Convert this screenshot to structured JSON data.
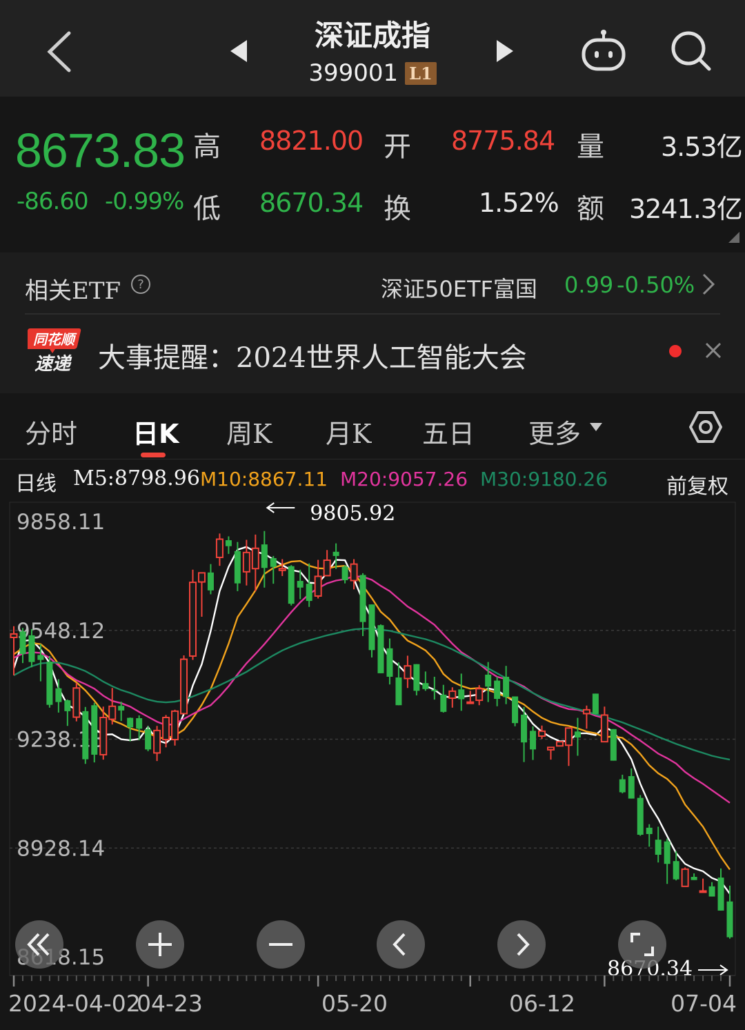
{
  "header": {
    "title": "深证成指",
    "code": "399001",
    "level": "L1"
  },
  "quote": {
    "price": "8673.83",
    "change": "-86.60",
    "change_pct": "-0.99%",
    "high_label": "高",
    "high": "8821.00",
    "open_label": "开",
    "open": "8775.84",
    "volume_label": "量",
    "volume": "3.53亿",
    "low_label": "低",
    "low": "8670.34",
    "turnover_label": "换",
    "turnover": "1.52%",
    "amount_label": "额",
    "amount": "3241.3亿"
  },
  "etf": {
    "label": "相关ETF",
    "name": "深证50ETF富国",
    "price": "0.99",
    "pct": "-0.50%"
  },
  "news": {
    "logo_top": "同花顺",
    "logo_bottom": "速递",
    "text": "大事提醒：2024世界人工智能大会"
  },
  "tabs": [
    {
      "label": "分时"
    },
    {
      "label": "日K"
    },
    {
      "label": "周K"
    },
    {
      "label": "月K"
    },
    {
      "label": "五日"
    },
    {
      "label": "更多"
    }
  ],
  "ma": {
    "kind": "日线",
    "m5": "M5:8798.96",
    "m10": "M10:8867.11",
    "m20": "M20:9057.26",
    "m30": "M30:9180.26",
    "adjust": "前复权"
  },
  "colors": {
    "up": "#f0433a",
    "down": "#2fb34a",
    "m5": "#ffffff",
    "m10": "#f2a31c",
    "m20": "#e2359e",
    "m30": "#1d8a62"
  },
  "chart_data": {
    "type": "candlestick",
    "y_ticks": [
      "9858.11",
      "9548.12",
      "9238.13",
      "8928.14",
      "8618.15"
    ],
    "x_ticks": [
      "2024-04-02",
      "04-23",
      "05-20",
      "06-12",
      "07-04"
    ],
    "high_marker": "9805.92",
    "low_marker": "8670.34",
    "ylim": [
      8618.15,
      9858.11
    ],
    "candles": [
      [
        9528,
        9538,
        9420,
        9560
      ],
      [
        9545,
        9481,
        9455,
        9555
      ],
      [
        9534,
        9458,
        9443,
        9552
      ],
      [
        9478,
        9464,
        9403,
        9509
      ],
      [
        9459,
        9336,
        9328,
        9475
      ],
      [
        9383,
        9344,
        9314,
        9409
      ],
      [
        9349,
        9318,
        9276,
        9351
      ],
      [
        9301,
        9384,
        9289,
        9399
      ],
      [
        9318,
        9181,
        9168,
        9330
      ],
      [
        9335,
        9194,
        9172,
        9342
      ],
      [
        9194,
        9300,
        9180,
        9331
      ],
      [
        9295,
        9332,
        9280,
        9384
      ],
      [
        9333,
        9320,
        9290,
        9345
      ],
      [
        9299,
        9272,
        9232,
        9300
      ],
      [
        9298,
        9268,
        9235,
        9306
      ],
      [
        9267,
        9209,
        9204,
        9275
      ],
      [
        9199,
        9263,
        9176,
        9276
      ],
      [
        9237,
        9300,
        9215,
        9307
      ],
      [
        9237,
        9318,
        9220,
        9322
      ],
      [
        9311,
        9466,
        9309,
        9477
      ],
      [
        9475,
        9685,
        9464,
        9721
      ],
      [
        9686,
        9712,
        9587,
        9709
      ],
      [
        9713,
        9662,
        9651,
        9737
      ],
      [
        9756,
        9808,
        9732,
        9824
      ],
      [
        9805,
        9788,
        9766,
        9816
      ],
      [
        9774,
        9682,
        9660,
        9800
      ],
      [
        9715,
        9770,
        9676,
        9806
      ],
      [
        9724,
        9782,
        9660,
        9821
      ],
      [
        9793,
        9726,
        9670,
        9831
      ],
      [
        9754,
        9729,
        9681,
        9760
      ],
      [
        9719,
        9724,
        9703,
        9751
      ],
      [
        9731,
        9624,
        9619,
        9734
      ],
      [
        9689,
        9670,
        9637,
        9721
      ],
      [
        9681,
        9632,
        9615,
        9739
      ],
      [
        9646,
        9702,
        9639,
        9749
      ],
      [
        9704,
        9748,
        9713,
        9777
      ],
      [
        9772,
        9760,
        9723,
        9796
      ],
      [
        9730,
        9691,
        9682,
        9734
      ],
      [
        9690,
        9737,
        9665,
        9751
      ],
      [
        9706,
        9572,
        9532,
        9711
      ],
      [
        9622,
        9492,
        9471,
        9616
      ],
      [
        9563,
        9426,
        9456,
        9565
      ],
      [
        9497,
        9416,
        9394,
        9525
      ],
      [
        9414,
        9335,
        9351,
        9457
      ],
      [
        9411,
        9447,
        9384,
        9476
      ],
      [
        9452,
        9376,
        9363,
        9452
      ],
      [
        9398,
        9381,
        9376,
        9431
      ],
      [
        9379,
        9375,
        9351,
        9416
      ],
      [
        9365,
        9316,
        9314,
        9393
      ],
      [
        9355,
        9375,
        9328,
        9386
      ],
      [
        9380,
        9352,
        9319,
        9425
      ],
      [
        9343,
        9344,
        9360,
        9376
      ],
      [
        9349,
        9382,
        9335,
        9392
      ],
      [
        9422,
        9388,
        9344,
        9458
      ],
      [
        9405,
        9353,
        9332,
        9416
      ],
      [
        9416,
        9358,
        9338,
        9447
      ],
      [
        9360,
        9284,
        9275,
        9337
      ],
      [
        9308,
        9229,
        9173,
        9330
      ],
      [
        9262,
        9209,
        9179,
        9275
      ],
      [
        9247,
        9261,
        9239,
        9277
      ],
      [
        9208,
        9215,
        9180,
        9209
      ],
      [
        9219,
        9231,
        9238,
        9233
      ],
      [
        9221,
        9270,
        9162,
        9239
      ],
      [
        9260,
        9243,
        9191,
        9299
      ],
      [
        9311,
        9322,
        9268,
        9334
      ],
      [
        9368,
        9310,
        9309,
        9346
      ],
      [
        9231,
        9307,
        9300,
        9331
      ],
      [
        9267,
        9177,
        9192,
        9217
      ],
      [
        9124,
        9087,
        9084,
        9137
      ],
      [
        9133,
        9069,
        9073,
        9155
      ],
      [
        9071,
        8966,
        8963,
        9079
      ],
      [
        8986,
        8968,
        8932,
        8996
      ],
      [
        8952,
        8909,
        8887,
        8989
      ],
      [
        8947,
        8883,
        8826,
        8955
      ],
      [
        8891,
        8839,
        8836,
        8919
      ],
      [
        8819,
        8868,
        8842,
        8873
      ],
      [
        8846,
        8837,
        8844,
        8856
      ],
      [
        8806,
        8806,
        8807,
        8841
      ],
      [
        8819,
        8790,
        8800,
        8831
      ],
      [
        8844,
        8750,
        8753,
        8870
      ],
      [
        8776,
        8674,
        8670,
        8821
      ]
    ],
    "series": [
      {
        "name": "M5",
        "values": [
          9440,
          9518,
          9521,
          9494,
          9455,
          9384,
          9336,
          9322,
          9302,
          9268,
          9251,
          9252,
          9238,
          9235,
          9239,
          9273,
          9235,
          9227,
          9250,
          9310,
          9391,
          9452,
          9546,
          9660,
          9729,
          9778,
          9786,
          9772,
          9766,
          9750,
          9734,
          9720,
          9715,
          9684,
          9682,
          9712,
          9749,
          9748,
          9695,
          9633,
          9580,
          9510,
          9468,
          9448,
          9421,
          9403,
          9390,
          9379,
          9360,
          9357,
          9359,
          9362,
          9366,
          9383,
          9377,
          9361,
          9344,
          9316,
          9282,
          9259,
          9244,
          9232,
          9233,
          9255,
          9255,
          9250,
          9273,
          9260,
          9224,
          9181,
          9111,
          9053,
          9012,
          8962,
          8914,
          8883,
          8870,
          8862,
          8843,
          8833,
          8798
        ]
      },
      {
        "name": "M10",
        "values": [
          9480,
          9498,
          9512,
          9509,
          9488,
          9452,
          9418,
          9400,
          9377,
          9348,
          9315,
          9292,
          9282,
          9269,
          9262,
          9257,
          9243,
          9240,
          9249,
          9265,
          9298,
          9336,
          9381,
          9443,
          9510,
          9586,
          9623,
          9662,
          9709,
          9726,
          9735,
          9744,
          9746,
          9732,
          9725,
          9724,
          9730,
          9732,
          9713,
          9676,
          9640,
          9601,
          9579,
          9546,
          9519,
          9506,
          9491,
          9465,
          9424,
          9402,
          9390,
          9382,
          9384,
          9378,
          9369,
          9359,
          9350,
          9337,
          9317,
          9299,
          9287,
          9280,
          9276,
          9269,
          9260,
          9255,
          9244,
          9246,
          9242,
          9223,
          9196,
          9164,
          9141,
          9125,
          9100,
          9052,
          9021,
          8989,
          8946,
          8903,
          8867
        ]
      },
      {
        "name": "M20",
        "values": [
          9470,
          9482,
          9486,
          9484,
          9470,
          9448,
          9423,
          9406,
          9395,
          9382,
          9362,
          9347,
          9341,
          9331,
          9316,
          9302,
          9288,
          9278,
          9282,
          9296,
          9310,
          9323,
          9335,
          9360,
          9389,
          9423,
          9454,
          9481,
          9509,
          9539,
          9570,
          9600,
          9628,
          9652,
          9668,
          9682,
          9690,
          9694,
          9702,
          9701,
          9692,
          9675,
          9660,
          9638,
          9616,
          9600,
          9582,
          9564,
          9537,
          9510,
          9486,
          9470,
          9453,
          9432,
          9416,
          9409,
          9400,
          9388,
          9370,
          9355,
          9343,
          9332,
          9324,
          9322,
          9315,
          9305,
          9298,
          9284,
          9269,
          9251,
          9234,
          9216,
          9197,
          9184,
          9169,
          9145,
          9127,
          9111,
          9093,
          9075,
          9057
        ]
      },
      {
        "name": "M30",
        "values": [
          9420,
          9434,
          9446,
          9454,
          9456,
          9456,
          9450,
          9442,
          9432,
          9418,
          9402,
          9389,
          9378,
          9370,
          9360,
          9351,
          9345,
          9343,
          9345,
          9351,
          9360,
          9370,
          9380,
          9392,
          9404,
          9417,
          9430,
          9446,
          9462,
          9477,
          9491,
          9502,
          9512,
          9520,
          9527,
          9534,
          9540,
          9546,
          9551,
          9553,
          9553,
          9550,
          9547,
          9541,
          9535,
          9529,
          9523,
          9515,
          9505,
          9494,
          9481,
          9468,
          9454,
          9440,
          9426,
          9412,
          9398,
          9384,
          9370,
          9357,
          9346,
          9338,
          9331,
          9324,
          9317,
          9309,
          9302,
          9294,
          9286,
          9276,
          9266,
          9256,
          9245,
          9235,
          9225,
          9216,
          9207,
          9199,
          9191,
          9185,
          9180
        ]
      }
    ]
  }
}
